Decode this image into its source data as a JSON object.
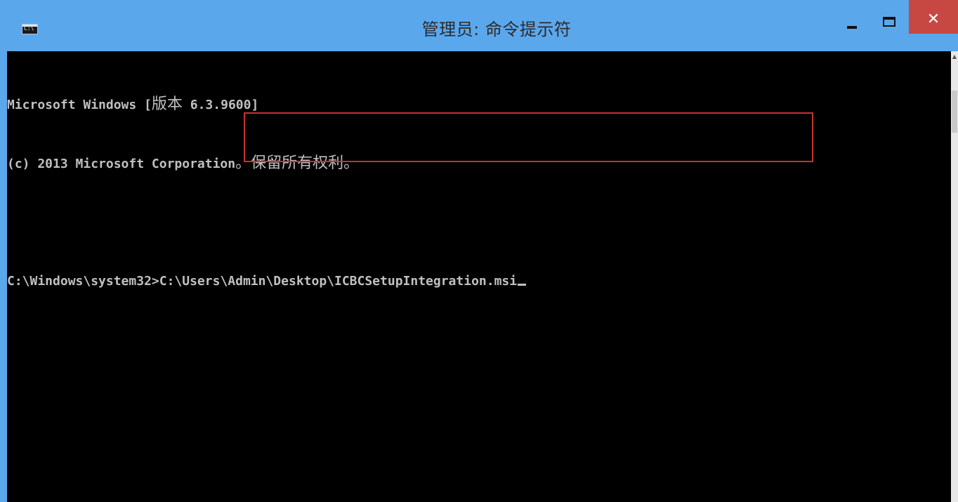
{
  "window": {
    "title": "管理员: 命令提示符",
    "icon_text": "C:\\",
    "icon_name": "cmd-icon",
    "minimize_symbol": "",
    "maximize_symbol": "",
    "close_symbol": "✕",
    "colors": {
      "titlebar": "#5ba7ec",
      "close_button": "#c74843",
      "console_bg": "#000000",
      "console_text": "#c0c0c0",
      "highlight": "#c8322e"
    }
  },
  "console": {
    "line1_prefix": "Microsoft Windows [",
    "line1_cjk": "版本",
    "line1_suffix": " 6.3.9600]",
    "line2_prefix": "(c) 2013 Microsoft Corporation",
    "line2_cjk": "。保留所有权利。",
    "prompt": "C:\\Windows\\system32>",
    "command": "C:\\Users\\Admin\\Desktop\\ICBCSetupIntegration.msi"
  },
  "scrollbar": {
    "up_arrow": "▲"
  }
}
